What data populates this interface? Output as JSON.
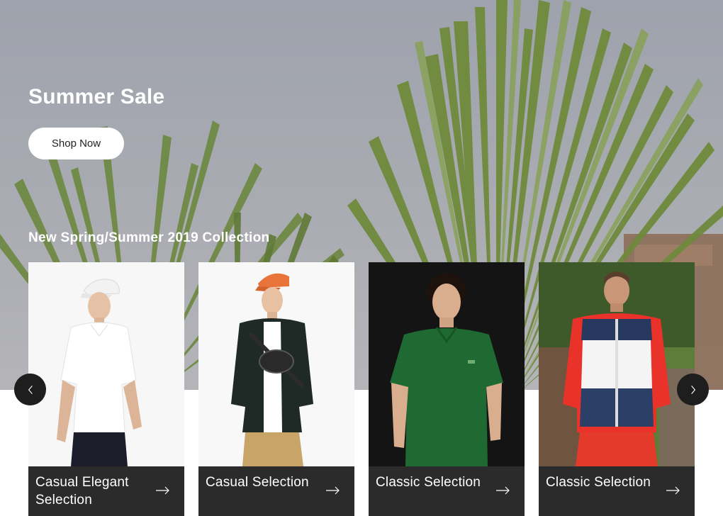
{
  "hero": {
    "title": "Summer Sale",
    "cta_label": "Shop Now",
    "collection_title": "New Spring/Summer 2019 Collection"
  },
  "carousel": {
    "prev_icon": "chevron-left-icon",
    "next_icon": "chevron-right-icon",
    "cards": [
      {
        "label": "Casual Elegant Selection",
        "photo": "man-white-polo-white-cap",
        "icon": "arrow-right-icon"
      },
      {
        "label": "Casual Selection",
        "photo": "man-black-jacket-orange-cap",
        "icon": "arrow-right-icon"
      },
      {
        "label": "Classic Selection",
        "photo": "man-green-polo",
        "icon": "arrow-right-icon"
      },
      {
        "label": "Classic Selection",
        "photo": "man-tracksuit-jacket",
        "icon": "arrow-right-icon"
      }
    ]
  },
  "colors": {
    "label_bar": "#2b2b2b",
    "nav_button": "#1e1e1e",
    "cta_bg": "#ffffff"
  }
}
